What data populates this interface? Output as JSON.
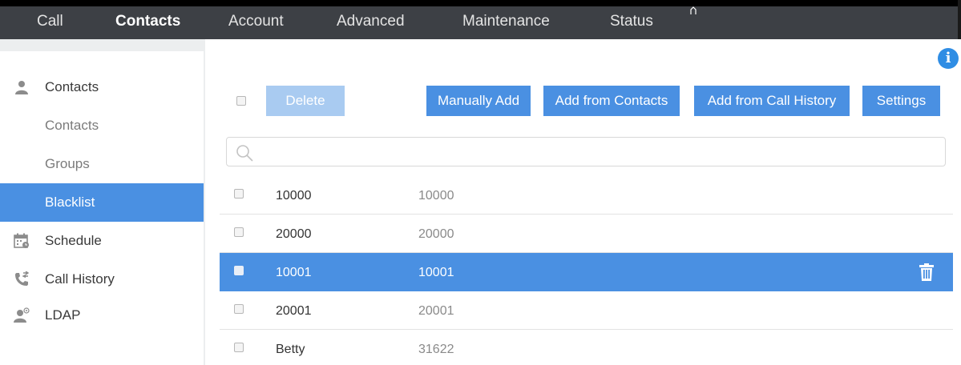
{
  "topnav": {
    "tabs": [
      {
        "label": "Call"
      },
      {
        "label": "Contacts"
      },
      {
        "label": "Account"
      },
      {
        "label": "Advanced"
      },
      {
        "label": "Maintenance"
      },
      {
        "label": "Status"
      }
    ],
    "active_tab": "Contacts"
  },
  "sidebar": {
    "items": [
      {
        "label": "Contacts",
        "icon": "person-icon"
      },
      {
        "label": "Contacts"
      },
      {
        "label": "Groups"
      },
      {
        "label": "Blacklist"
      },
      {
        "label": "Schedule",
        "icon": "calendar-icon"
      },
      {
        "label": "Call History",
        "icon": "phone-history-icon"
      },
      {
        "label": "LDAP",
        "icon": "ldap-user-icon"
      }
    ],
    "active_item": "Blacklist"
  },
  "toolbar": {
    "delete_label": "Delete",
    "manually_add_label": "Manually Add",
    "add_from_contacts_label": "Add from Contacts",
    "add_from_call_history_label": "Add from Call History",
    "settings_label": "Settings"
  },
  "search": {
    "placeholder": "",
    "value": ""
  },
  "blacklist": {
    "rows": [
      {
        "name": "10000",
        "number": "10000",
        "selected": false
      },
      {
        "name": "20000",
        "number": "20000",
        "selected": false
      },
      {
        "name": "10001",
        "number": "10001",
        "selected": true
      },
      {
        "name": "20001",
        "number": "20001",
        "selected": false
      },
      {
        "name": "Betty",
        "number": "31622",
        "selected": false
      }
    ]
  },
  "colors": {
    "accent": "#4a90e2",
    "nav_bg": "#3d4045",
    "nav_active_underline": "#e96e3a",
    "info_blue": "#2f8de4"
  }
}
